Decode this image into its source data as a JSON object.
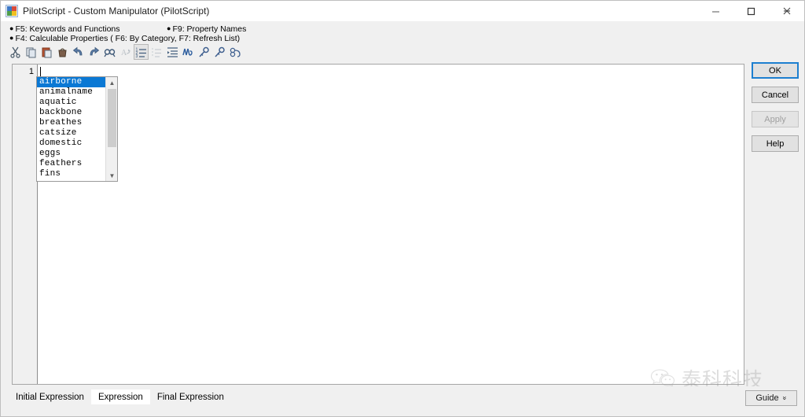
{
  "window": {
    "title": "PilotScript - Custom Manipulator (PilotScript)",
    "app_icon": "pilotscript-app-icon",
    "controls": {
      "minimize": "minimize-icon",
      "maximize": "maximize-icon",
      "close": "close-icon"
    }
  },
  "hints": {
    "line1": "F5: Keywords and Functions",
    "line2": "F4: Calculable Properties ( F6: By Category, F7: Refresh List)",
    "line3": "F9: Property Names",
    "bullet": "●"
  },
  "toolbar": {
    "items": [
      {
        "name": "cut-icon",
        "tip": "Cut",
        "state": "enabled"
      },
      {
        "name": "copy-icon",
        "tip": "Copy",
        "state": "enabled"
      },
      {
        "name": "paste-icon",
        "tip": "Paste",
        "state": "enabled"
      },
      {
        "name": "delete-icon",
        "tip": "Delete",
        "state": "enabled"
      },
      {
        "name": "undo-icon",
        "tip": "Undo",
        "state": "enabled"
      },
      {
        "name": "redo-icon",
        "tip": "Redo",
        "state": "enabled"
      },
      {
        "name": "find-icon",
        "tip": "Find",
        "state": "enabled"
      },
      {
        "name": "replace-icon",
        "tip": "Replace",
        "state": "disabled"
      },
      {
        "name": "line-numbers-icon",
        "tip": "Line Numbers",
        "state": "active"
      },
      {
        "name": "indent-guides-icon",
        "tip": "Indent Guides",
        "state": "disabled"
      },
      {
        "name": "indent-icon",
        "tip": "Indent",
        "state": "enabled"
      },
      {
        "name": "check-syntax-icon",
        "tip": "Check Syntax",
        "state": "enabled"
      },
      {
        "name": "key-icon",
        "tip": "Keywords",
        "state": "enabled"
      },
      {
        "name": "key-alt-icon",
        "tip": "Properties",
        "state": "enabled"
      },
      {
        "name": "link-icon",
        "tip": "Bind",
        "state": "enabled"
      }
    ]
  },
  "editor": {
    "line_number": "1",
    "code_value": "",
    "placeholder": ""
  },
  "autocomplete": {
    "selected": "airborne",
    "items": [
      "airborne",
      "animalname",
      "aquatic",
      "backbone",
      "breathes",
      "catsize",
      "domestic",
      "eggs",
      "feathers",
      "fins"
    ],
    "scroll_up": "▲",
    "scroll_down": "▼"
  },
  "buttons": {
    "ok": {
      "label": "OK",
      "accel": "O",
      "state": "focused"
    },
    "cancel": {
      "label": "Cancel",
      "accel": "C",
      "state": "enabled"
    },
    "apply": {
      "label": "Apply",
      "accel": "A",
      "state": "disabled"
    },
    "help": {
      "label": "Help",
      "accel": "H",
      "state": "enabled"
    }
  },
  "tabs": [
    {
      "label": "Initial Expression",
      "active": false
    },
    {
      "label": "Expression",
      "active": true
    },
    {
      "label": "Final Expression",
      "active": false
    }
  ],
  "guide": {
    "label": "Guide",
    "chevron": "»"
  },
  "watermark": {
    "text": "泰科科技",
    "logo": "wechat-logo-icon"
  },
  "colors": {
    "selection_blue": "#0a78d4",
    "focus_blue": "#1d7fd0",
    "window_bg": "#f0f0f0",
    "panel_bg": "#ffffff",
    "icon_blue": "#4a6fa5"
  }
}
